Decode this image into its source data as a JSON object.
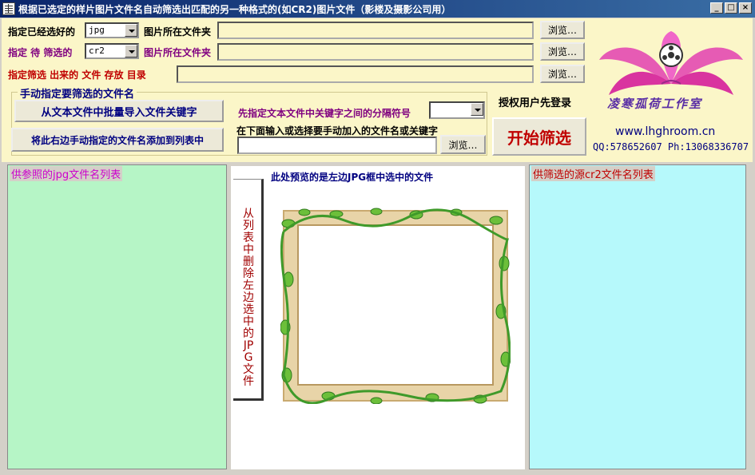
{
  "window": {
    "title": "根据已选定的样片图片文件名自动筛选出匹配的另一种格式的(如CR2)图片文件（影楼及摄影公司用）",
    "controls": [
      "_",
      "□",
      "×"
    ]
  },
  "row1": {
    "label": "指定已经选好的",
    "format": "jpg",
    "folder_label": "图片所在文件夹",
    "browse": "浏览…"
  },
  "row2": {
    "label": "指定 待 筛选的",
    "format": "cr2",
    "folder_label": "图片所在文件夹",
    "browse": "浏览…"
  },
  "row3": {
    "label": "指定筛选 出来的 文件 存放 目录",
    "browse": "浏览…"
  },
  "group": {
    "title": "手动指定要筛选的文件名",
    "import_button": "从文本文件中批量导入文件关键字",
    "add_button": "将此右边手动指定的文件名添加到列表中",
    "separator_label": "先指定文本文件中关键字之间的分隔符号",
    "separator_value": "",
    "input_label": "在下面输入或选择要手动加入的文件名或关键字",
    "browse": "浏览…"
  },
  "auth_label": "授权用户先登录",
  "start_button": "开始筛选",
  "brand": {
    "studio_name": "凌寒孤荷工作室",
    "url": "www.lhghroom.cn",
    "contact": "QQ:578652607 Ph:13068336707"
  },
  "left_panel": {
    "caption": "供参照的jpg文件名列表"
  },
  "right_panel": {
    "caption": "供筛选的源cr2文件名列表"
  },
  "preview": {
    "caption": "此处预览的是左边JPG框中选中的文件",
    "remove_button": "从列表中删除左边选中的JPG文件"
  },
  "colors": {
    "top_panel_bg": "#fbf6c8",
    "left_list_bg": "#b6f5c6",
    "right_list_bg": "#b6f9fb",
    "accent_red": "#c00000",
    "accent_navy": "#000080"
  }
}
